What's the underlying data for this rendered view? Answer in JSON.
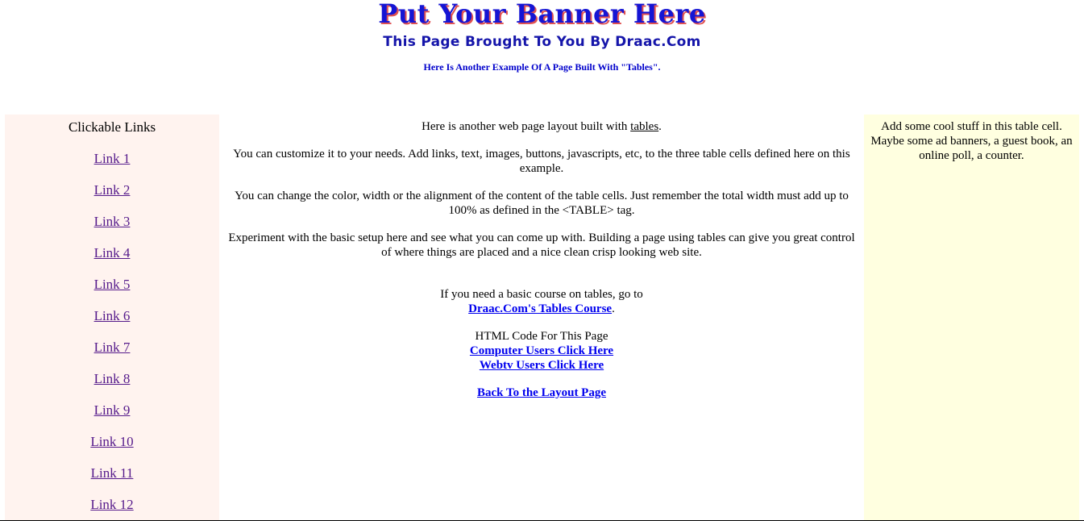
{
  "header": {
    "banner_title": "Put Your Banner Here",
    "banner_subtitle": "This Page Brought To You By Draac.Com",
    "note": "Here Is Another Example Of A Page Built With \"Tables\"."
  },
  "left": {
    "heading": "Clickable Links",
    "links": [
      "Link 1",
      "Link 2",
      "Link 3",
      "Link 4",
      "Link 5",
      "Link 6",
      "Link 7",
      "Link 8",
      "Link 9",
      "Link 10",
      "Link 11",
      "Link 12"
    ]
  },
  "main": {
    "p1_before": "Here is another web page layout built with ",
    "p1_link": "tables",
    "p1_after": ".",
    "p2": "You can customize it to your needs. Add links, text, images, buttons, javascripts, etc, to the three table cells defined here on this example.",
    "p3": "You can change the color, width or the alignment of the content of the table cells. Just remember the total width must add up to 100% as defined in the <TABLE> tag.",
    "p4": "Experiment with the basic setup here and see what you can come up with. Building a page using tables can give you great control of where things are placed and a nice clean crisp looking web site.",
    "course_text": "If you need a basic course on tables, go to",
    "course_link": "Draac.Com's Tables Course",
    "course_after": ".",
    "code_heading": "HTML Code For This Page",
    "computer_link": "Computer Users Click Here",
    "webtv_link": "Webtv Users Click Here",
    "back_link": "Back To the Layout Page"
  },
  "right": {
    "text": "Add some cool stuff in this table cell. Maybe some ad banners, a guest book, an online poll, a counter."
  },
  "colors": {
    "banner": "#1515d4",
    "left_bg": "#fff3ef",
    "right_bg": "#ffffe0",
    "visited_link": "#551a8b",
    "link": "#0000ee"
  }
}
